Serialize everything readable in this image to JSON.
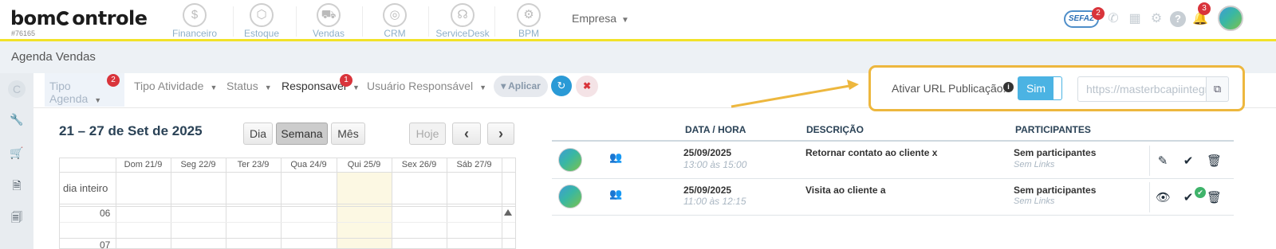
{
  "topbar": {
    "logo": {
      "left": "bom",
      "right": "ontrole"
    },
    "account_id": "#76165",
    "modules": [
      {
        "label": "Financeiro",
        "icon": "dollar-icon",
        "glyph": "$"
      },
      {
        "label": "Estoque",
        "icon": "box-icon",
        "glyph": "⬡"
      },
      {
        "label": "Vendas",
        "icon": "cart-icon",
        "glyph": "⛟"
      },
      {
        "label": "CRM",
        "icon": "target-icon",
        "glyph": "◎"
      },
      {
        "label": "ServiceDesk",
        "icon": "headset-icon",
        "glyph": "☊"
      },
      {
        "label": "BPM",
        "icon": "network-icon",
        "glyph": "⚙"
      }
    ],
    "empresa_label": "Empresa",
    "sefaz_label": "SEFAZ",
    "sefaz_count": "2",
    "notifications_count": "3"
  },
  "page": {
    "title": "Agenda Vendas"
  },
  "filters": {
    "tipo_agenda": "Tipo Agenda",
    "tipo_agenda_count": "2",
    "tipo_atividade": "Tipo Atividade",
    "status": "Status",
    "responsavel": "Responsavel",
    "responsavel_count": "1",
    "usuario_responsavel": "Usuário Responsável",
    "aplicar": "Aplicar"
  },
  "publication": {
    "label": "Ativar URL Publicação:",
    "toggle_value": "Sim",
    "url": "https://masterbcapiintegracao"
  },
  "calendar": {
    "title": "21 – 27 de Set de 2025",
    "views": {
      "day": "Dia",
      "week": "Semana",
      "month": "Mês"
    },
    "today": "Hoje",
    "prev": "‹",
    "next": "›",
    "days": [
      "Dom 21/9",
      "Seg 22/9",
      "Ter 23/9",
      "Qua 24/9",
      "Qui 25/9",
      "Sex 26/9",
      "Sáb 27/9"
    ],
    "all_day": "dia inteiro",
    "hours": [
      "06",
      "07"
    ]
  },
  "events_table": {
    "headers": {
      "date_time": "DATA / HORA",
      "description": "DESCRIÇÃO",
      "participants": "PARTICIPANTES"
    },
    "rows": [
      {
        "date": "25/09/2025",
        "time": "13:00 às 15:00",
        "description": "Retornar contato ao cliente x",
        "participants": "Sem participantes",
        "links": "Sem Links"
      },
      {
        "date": "25/09/2025",
        "time": "11:00 às 12:15",
        "description": "Visita ao cliente a",
        "participants": "Sem participantes",
        "links": "Sem Links"
      }
    ]
  },
  "colors": {
    "accent_yellow": "#f2e229",
    "highlight_border": "#edb73e",
    "primary_blue": "#2a9ad6",
    "badge_red": "#d9343b"
  }
}
